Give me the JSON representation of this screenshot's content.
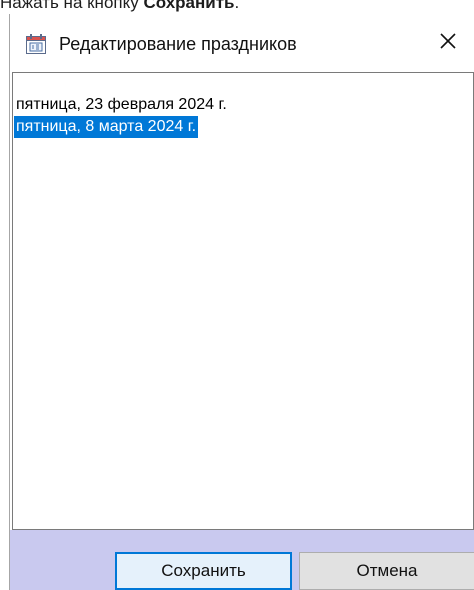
{
  "instruction": {
    "prefix": "Нажать на кнопку ",
    "bold": "Сохранить",
    "suffix": "."
  },
  "dialog": {
    "title": "Редактирование праздников",
    "close_symbol": "✕",
    "icon": "calendar-icon"
  },
  "list": {
    "items": [
      {
        "label": "пятница, 23 февраля 2024 г.",
        "selected": false
      },
      {
        "label": "пятница, 8 марта 2024 г.",
        "selected": true
      }
    ]
  },
  "buttons": {
    "save_label": "Сохранить",
    "cancel_label": "Отмена"
  },
  "colors": {
    "selection": "#0078d7",
    "footer": "#c9c9ef",
    "default_button_border": "#0078d7"
  }
}
